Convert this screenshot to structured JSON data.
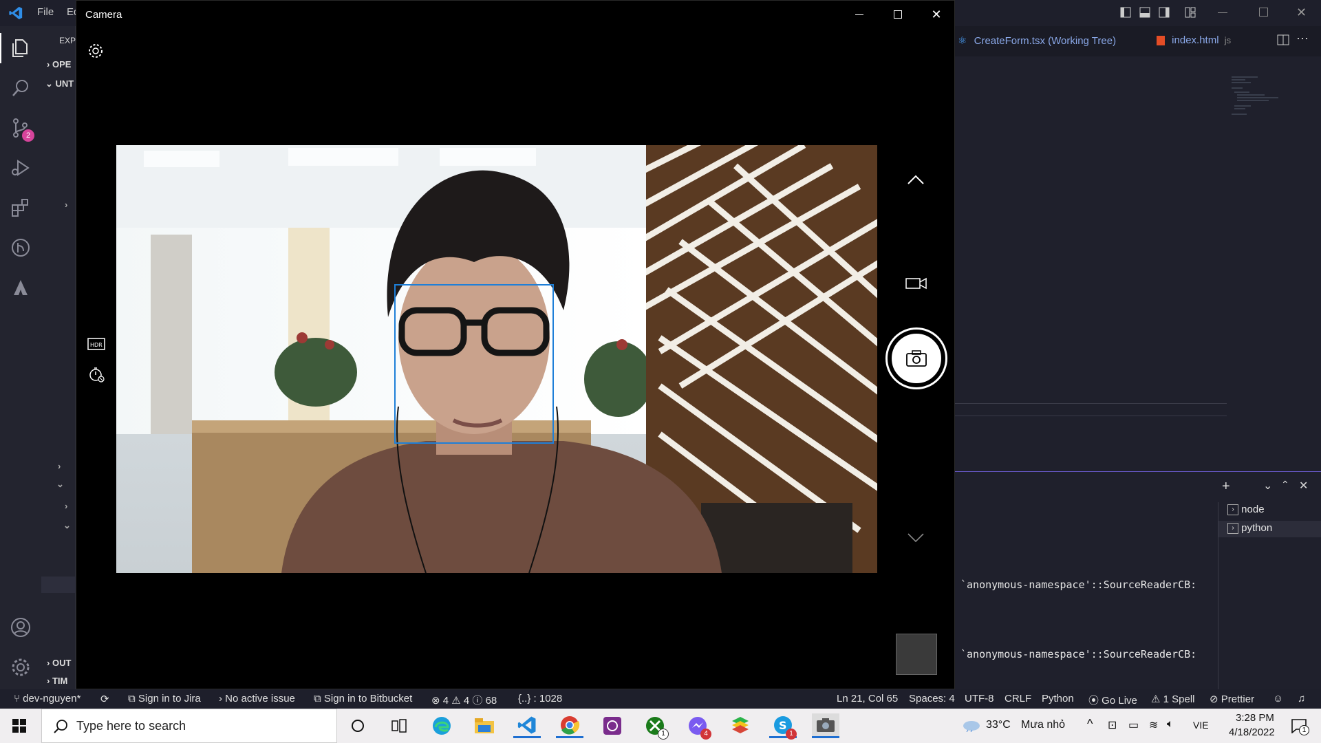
{
  "vscode": {
    "menu": {
      "file": "File",
      "edit": "Ed"
    },
    "sidebar": {
      "explorer_title": "EXP",
      "open_editors": "OPE",
      "untitled": "UNT",
      "outline": "OUT",
      "timeline": "TIM"
    },
    "scm_badge": "2",
    "tabs": [
      {
        "label": "CreateForm.tsx (Working Tree)"
      },
      {
        "label": "index.html",
        "suffix": "js"
      }
    ],
    "terminal": {
      "list": [
        "node",
        "python"
      ],
      "lines": [
        "`anonymous-namespace'::SourceReaderCB:",
        "`anonymous-namespace'::SourceReaderCB:"
      ]
    }
  },
  "camera": {
    "title": "Camera"
  },
  "statusbar": {
    "branch": "dev-nguyen*",
    "jira": "Sign in to Jira",
    "issue": "No active issue",
    "bitbucket": "Sign in to Bitbucket",
    "errors": "4",
    "warnings": "4",
    "infos": "68",
    "braces": "{..} : 1028",
    "position": "Ln 21, Col 65",
    "spaces": "Spaces: 4",
    "encoding": "UTF-8",
    "eol": "CRLF",
    "language": "Python",
    "golive": "Go Live",
    "spell": "1 Spell",
    "prettier": "Prettier"
  },
  "taskbar": {
    "search_placeholder": "Type here to search",
    "weather_temp": "33°C",
    "weather_desc": "Mưa nhỏ",
    "lang": "VIE",
    "time": "3:28 PM",
    "date": "4/18/2022",
    "notif_count": "1",
    "badges": {
      "xbox": "1",
      "messenger": "4",
      "skype": "1"
    }
  },
  "colors": {
    "accent": "#1e7fd8",
    "vscode_bg": "#1e1f2b",
    "taskbar_bg": "#f0eef0"
  }
}
